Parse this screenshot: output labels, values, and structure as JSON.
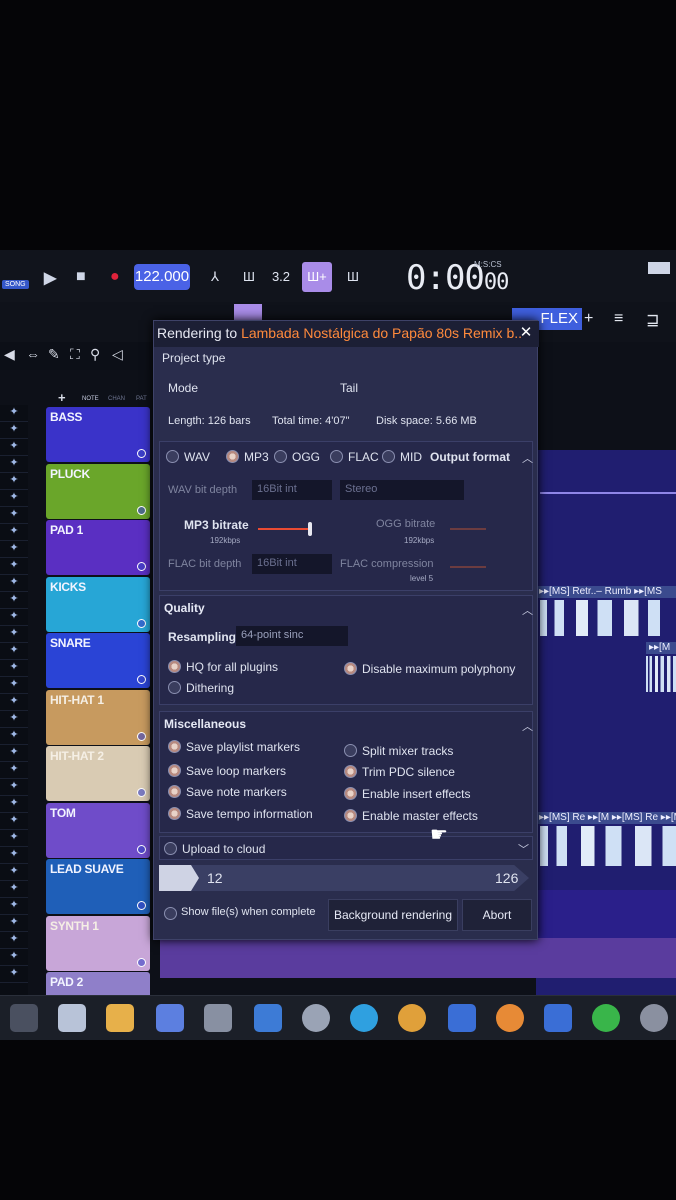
{
  "transport": {
    "song_mode": "SONG",
    "tempo": "122.000",
    "time": "0:00",
    "time_small": "00",
    "time_label": "M:S:CS",
    "snap_label": "3.2",
    "flex": "FLEX"
  },
  "tool_strip": {
    "note_label": "NOTE",
    "chan_label": "CHAN",
    "pat_label": "PAT"
  },
  "channels": [
    {
      "name": "BASS",
      "color": "#3a33c9"
    },
    {
      "name": "PLUCK",
      "color": "#6aa62a"
    },
    {
      "name": "PAD 1",
      "color": "#5a2fc2"
    },
    {
      "name": "KICKS",
      "color": "#27a6d6"
    },
    {
      "name": "SNARE",
      "color": "#2a44d6"
    },
    {
      "name": "HIT-HAT 1",
      "color": "#c79a5f"
    },
    {
      "name": "HIT-HAT 2",
      "color": "#d9cbb3"
    },
    {
      "name": "TOM",
      "color": "#6f4cc9"
    },
    {
      "name": "LEAD SUAVE",
      "color": "#1f5fb8"
    },
    {
      "name": "SYNTH 1",
      "color": "#c8a6d8"
    },
    {
      "name": "PAD 2",
      "color": "#8f7fc9"
    }
  ],
  "playlist": {
    "clip1": "▸▸[MS] Retr..– Rumb ▸▸[MS",
    "clip2": "▸▸[M",
    "clip3": "▸▸[MS] Re ▸▸[M ▸▸[MS] Re ▸▸[M"
  },
  "dialog": {
    "title_prefix": "Rendering to",
    "title_song": "Lambada Nostálgica do Papão 80s Remix b..",
    "project_type": "Project type",
    "mode": "Mode",
    "tail": "Tail",
    "length": "Length: 126 bars",
    "total_time": "Total time: 4'07\"",
    "disk_space": "Disk space: 5.66 MB",
    "formats": [
      "WAV",
      "MP3",
      "OGG",
      "FLAC",
      "MID"
    ],
    "selected_format": "MP3",
    "output_format": "Output format",
    "wav_bit_depth": "WAV bit depth",
    "wav_bit_value": "16Bit int",
    "wav_channels": "Stereo",
    "mp3_bitrate": "MP3 bitrate",
    "mp3_bitrate_value": "192kbps",
    "ogg_bitrate": "OGG bitrate",
    "ogg_bitrate_value": "192kbps",
    "flac_bit_depth": "FLAC bit depth",
    "flac_bit_value": "16Bit int",
    "flac_compression": "FLAC compression",
    "flac_compression_value": "level 5",
    "quality": "Quality",
    "resampling": "Resampling",
    "resampling_value": "64-point sinc",
    "hq_plugins": "HQ for all plugins",
    "disable_polyphony": "Disable maximum polyphony",
    "dithering": "Dithering",
    "misc": "Miscellaneous",
    "save_playlist_markers": "Save playlist markers",
    "save_loop_markers": "Save loop markers",
    "save_note_markers": "Save note markers",
    "save_tempo_info": "Save tempo information",
    "split_mixer_tracks": "Split mixer tracks",
    "trim_pdc": "Trim PDC silence",
    "enable_insert": "Enable insert effects",
    "enable_master": "Enable master effects",
    "upload_cloud": "Upload to cloud",
    "progress_current": "12",
    "progress_total": "126",
    "progress_fraction": 0.095,
    "show_files": "Show file(s) when complete",
    "background_rendering": "Background rendering",
    "abort": "Abort"
  }
}
